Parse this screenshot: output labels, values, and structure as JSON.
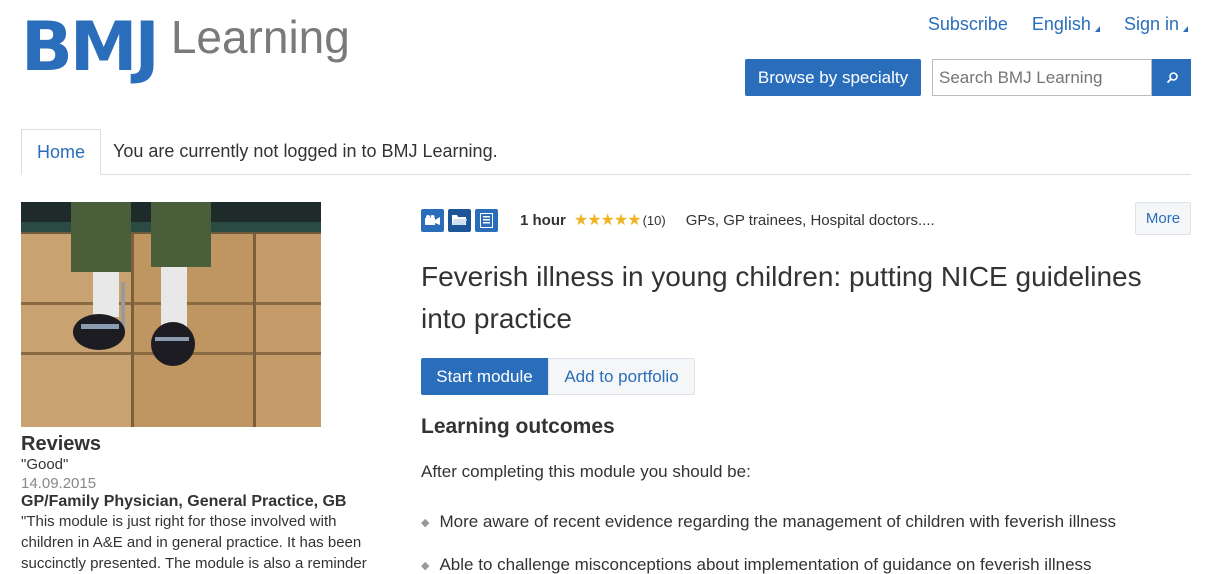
{
  "header": {
    "logo_bmj": "BMJ",
    "logo_learning": "Learning",
    "links": [
      "Subscribe",
      "English",
      "Sign in"
    ],
    "browse_label": "Browse by specialty",
    "search_placeholder": "Search BMJ Learning"
  },
  "nav": {
    "home_tab": "Home",
    "login_message": "You are currently not logged in to BMJ Learning."
  },
  "reviews": {
    "heading": "Reviews",
    "quote": "\"Good\"",
    "date": "14.09.2015",
    "author": "GP/Family Physician, General Practice, GB",
    "text": "\"This module is just right for those involved with children in A&E and in general practice. It has been succinctly presented. The module is also a reminder"
  },
  "module": {
    "icons": [
      "video-icon",
      "folder-icon",
      "document-icon"
    ],
    "duration": "1 hour",
    "stars": "★★★★★",
    "rating_count": "(10)",
    "audience": "GPs, GP trainees, Hospital doctors....",
    "more_label": "More",
    "title": "Feverish illness in young children: putting NICE guidelines into practice",
    "start_label": "Start module",
    "portfolio_label": "Add to portfolio"
  },
  "learning_outcomes": {
    "heading": "Learning outcomes",
    "intro": "After completing this module you should be:",
    "items": [
      "More aware of recent evidence regarding the management of children with feverish illness",
      "Able to challenge misconceptions about implementation of guidance on feverish illness"
    ]
  },
  "colors": {
    "brand_blue": "#2a6ebb",
    "star_gold": "#f0b323"
  }
}
